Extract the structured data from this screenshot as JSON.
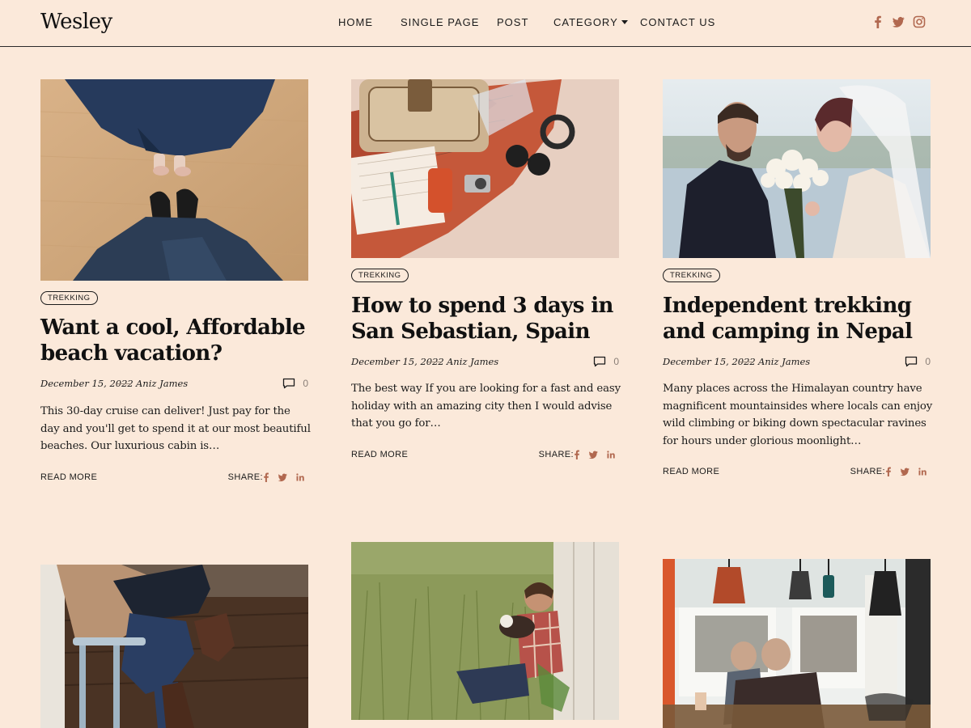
{
  "header": {
    "logo": "Wesley",
    "nav": [
      {
        "label": "HOME"
      },
      {
        "label": "SINGLE PAGE"
      },
      {
        "label": "POST"
      },
      {
        "label": "CATEGORY"
      },
      {
        "label": "CONTACT US"
      }
    ],
    "social_icons": [
      "facebook-icon",
      "twitter-icon",
      "instagram-icon"
    ]
  },
  "posts": [
    {
      "category": "TREKKING",
      "title": "Want a cool, Affordable beach vacation?",
      "date": "December 15, 2022",
      "author": "Aniz James",
      "comments": "0",
      "excerpt": "This 30-day cruise can deliver! Just pay for the day and you'll get to spend it at our most beautiful beaches. Our luxurious cabin is…",
      "read_more": "READ MORE",
      "share_label": "SHARE:",
      "image": "feet-on-wooden-floor-photo"
    },
    {
      "category": "TREKKING",
      "title": "How to spend 3 days in San Sebastian, Spain",
      "date": "December 15, 2022",
      "author": "Aniz James",
      "comments": "0",
      "excerpt": "The best way If you are looking for a fast and easy holiday with an amazing city then I would advise that you go for…",
      "read_more": "READ MORE",
      "share_label": "SHARE:",
      "image": "travel-flatlay-photo"
    },
    {
      "category": "TREKKING",
      "title": "Independent trekking and camping in Nepal",
      "date": "December 15, 2022",
      "author": "Aniz James",
      "comments": "0",
      "excerpt": "Many places across the Himalayan country have magnificent mountainsides where locals can enjoy wild climbing or biking down spectacular ravines for hours under glorious moonlight…",
      "read_more": "READ MORE",
      "share_label": "SHARE:",
      "image": "wedding-couple-photo"
    },
    {
      "image": "person-on-stool-photo"
    },
    {
      "image": "man-with-dog-in-grass-photo"
    },
    {
      "image": "cafe-interior-photo"
    }
  ],
  "colors": {
    "background": "#fbe9da",
    "accent": "#b1684f",
    "text": "#1b1b1b"
  }
}
